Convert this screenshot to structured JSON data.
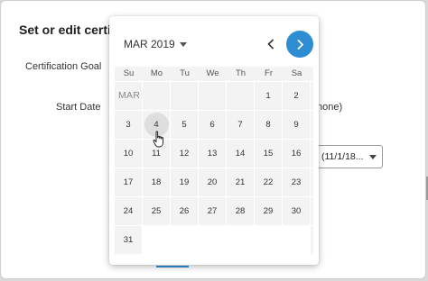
{
  "dialog": {
    "title": "Set or edit certif",
    "certification_goal_label": "Certification Goal",
    "start_date_label": "Start Date",
    "side_note": "none)",
    "date_select_value": "(11/1/18..."
  },
  "calendar": {
    "month_select": "MAR 2019",
    "month_label": "MAR",
    "weekdays": [
      "Su",
      "Mo",
      "Tu",
      "We",
      "Th",
      "Fr",
      "Sa"
    ],
    "weeks": [
      [
        "",
        "",
        "",
        "",
        "",
        "1",
        "2"
      ],
      [
        "3",
        "4",
        "5",
        "6",
        "7",
        "8",
        "9"
      ],
      [
        "10",
        "11",
        "12",
        "13",
        "14",
        "15",
        "16"
      ],
      [
        "17",
        "18",
        "19",
        "20",
        "21",
        "22",
        "23"
      ],
      [
        "24",
        "25",
        "26",
        "27",
        "28",
        "29",
        "30"
      ],
      [
        "31",
        "",
        "",
        "",
        "",
        "",
        ""
      ]
    ],
    "hovered_day": "4"
  },
  "icons": {
    "prev": "chevron-left-icon",
    "next": "chevron-right-icon",
    "dropdown": "caret-down-icon",
    "cursor": "hand-pointer-icon"
  },
  "colors": {
    "accent": "#2d8dd2",
    "cell_bg": "#f3f3f3",
    "hover_bg": "#dedede"
  }
}
